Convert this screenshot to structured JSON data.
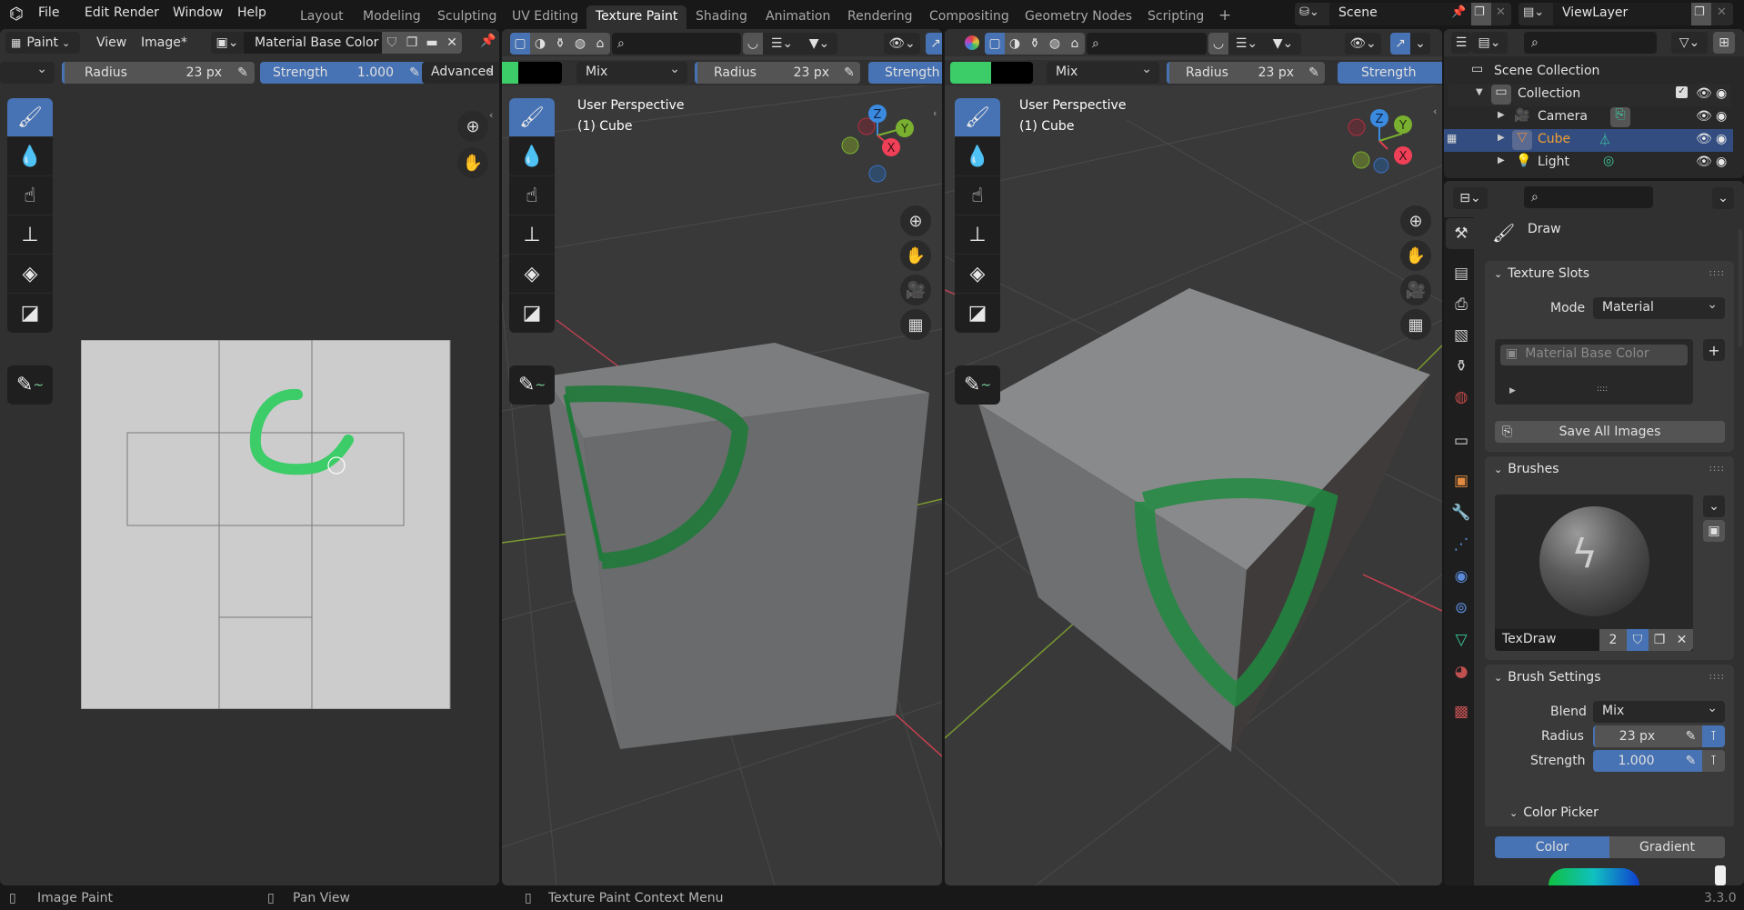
{
  "topbar": {
    "menus": [
      "File",
      "Edit",
      "Render",
      "Window",
      "Help"
    ],
    "workspaces": [
      "Layout",
      "Modeling",
      "Sculpting",
      "UV Editing",
      "Texture Paint",
      "Shading",
      "Animation",
      "Rendering",
      "Compositing",
      "Geometry Nodes",
      "Scripting"
    ],
    "active_workspace": "Texture Paint",
    "add_workspace": "+",
    "scene": "Scene",
    "view_layer": "ViewLayer"
  },
  "image_editor": {
    "mode": "Paint",
    "view_menu": "View",
    "image_menu": "Image*",
    "image_name": "Material Base Color",
    "radius_label": "Radius",
    "radius_value": "23 px",
    "strength_label": "Strength",
    "strength_value": "1.000",
    "advanced": "Advanced",
    "tools": [
      "draw",
      "soften",
      "smear",
      "clone",
      "fill",
      "mask"
    ]
  },
  "viewport1": {
    "blend": "Mix",
    "radius_label": "Radius",
    "radius_value": "23 px",
    "strength_label": "Strength",
    "perspective": "User Perspective",
    "object": "(1) Cube",
    "primary_color": "#3ccc68",
    "secondary_color": "#000000"
  },
  "viewport2": {
    "blend": "Mix",
    "radius_label": "Radius",
    "radius_value": "23 px",
    "strength_label": "Strength",
    "perspective": "User Perspective",
    "object": "(1) Cube",
    "primary_color": "#3ccc68",
    "secondary_color": "#000000"
  },
  "gizmo": {
    "x": "X",
    "y": "Y",
    "z": "Z"
  },
  "outliner": {
    "scene_collection": "Scene Collection",
    "items": [
      {
        "name": "Collection",
        "type": "collection"
      },
      {
        "name": "Camera",
        "type": "camera"
      },
      {
        "name": "Cube",
        "type": "mesh",
        "selected": true
      },
      {
        "name": "Light",
        "type": "light"
      }
    ]
  },
  "properties": {
    "tool_name": "Draw",
    "texture_slots": {
      "title": "Texture Slots",
      "mode_label": "Mode",
      "mode_value": "Material",
      "slot": "Material Base Color",
      "save_all": "Save All Images"
    },
    "brushes": {
      "title": "Brushes",
      "brush_name": "TexDraw",
      "users": "2"
    },
    "brush_settings": {
      "title": "Brush Settings",
      "blend_label": "Blend",
      "blend_value": "Mix",
      "radius_label": "Radius",
      "radius_value": "23 px",
      "strength_label": "Strength",
      "strength_value": "1.000"
    },
    "color_picker": {
      "title": "Color Picker",
      "tab_color": "Color",
      "tab_gradient": "Gradient"
    }
  },
  "statusbar": {
    "left": "Image Paint",
    "middle": "Pan View",
    "right": "Texture Paint Context Menu",
    "version": "3.3.0"
  }
}
